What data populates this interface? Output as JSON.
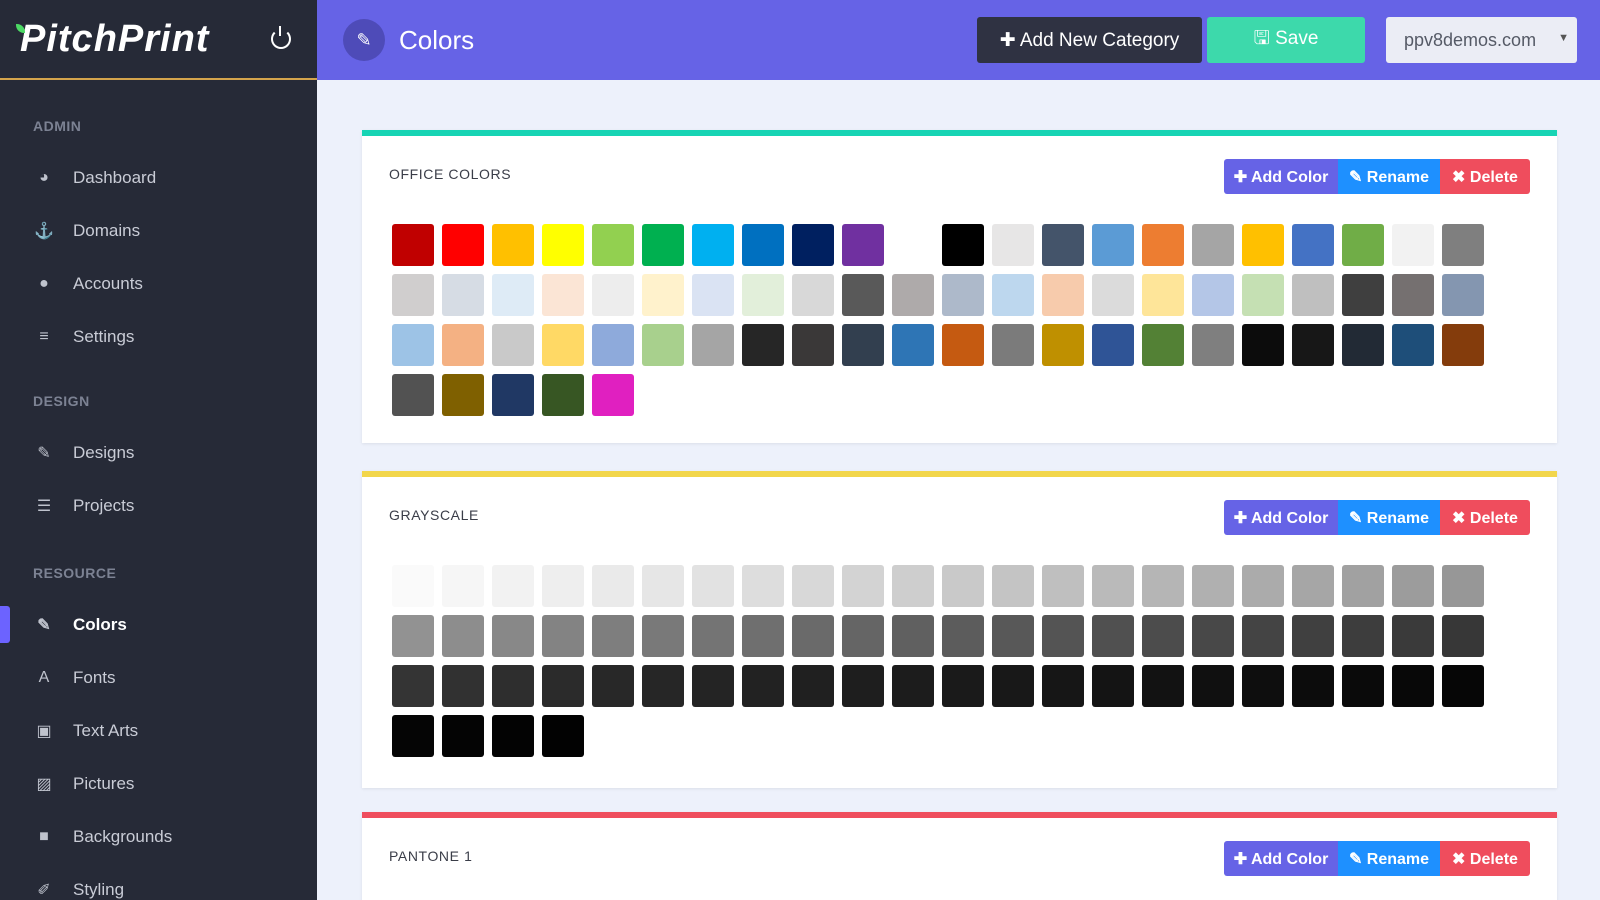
{
  "app": {
    "logo": "PitchPrint"
  },
  "sidebar": {
    "sections": [
      {
        "label": "ADMIN",
        "items": [
          {
            "label": "Dashboard",
            "icon": "dashboard-icon"
          },
          {
            "label": "Domains",
            "icon": "anchor-icon"
          },
          {
            "label": "Accounts",
            "icon": "user-icon"
          },
          {
            "label": "Settings",
            "icon": "sliders-icon"
          }
        ]
      },
      {
        "label": "DESIGN",
        "items": [
          {
            "label": "Designs",
            "icon": "edit-icon"
          },
          {
            "label": "Projects",
            "icon": "list-icon"
          }
        ]
      },
      {
        "label": "RESOURCE",
        "items": [
          {
            "label": "Colors",
            "icon": "eyedropper-icon",
            "active": true
          },
          {
            "label": "Fonts",
            "icon": "font-icon"
          },
          {
            "label": "Text Arts",
            "icon": "textart-icon"
          },
          {
            "label": "Pictures",
            "icon": "picture-icon"
          },
          {
            "label": "Backgrounds",
            "icon": "square-icon"
          },
          {
            "label": "Styling",
            "icon": "brush-icon"
          }
        ]
      }
    ]
  },
  "header": {
    "title": "Colors",
    "add_category_label": "Add New Category",
    "save_label": "Save",
    "domain_value": "ppv8demos.com"
  },
  "actions": {
    "add": "Add Color",
    "rename": "Rename",
    "delete": "Delete"
  },
  "categories": [
    {
      "name": "OFFICE COLORS",
      "accent": "#17d4b4",
      "swatches": [
        "#c00000",
        "#ff0000",
        "#ffc000",
        "#ffff00",
        "#92d050",
        "#00b050",
        "#00b0f0",
        "#0070c0",
        "#002060",
        "#7030a0",
        "#ffffff",
        "#000000",
        "#e7e6e6",
        "#44546a",
        "#5b9bd5",
        "#ed7d31",
        "#a5a5a5",
        "#ffc000",
        "#4472c4",
        "#70ad47",
        "#f2f2f2",
        "#7f7f7f",
        "#d0cece",
        "#d6dce4",
        "#deebf6",
        "#fbe5d5",
        "#ededed",
        "#fff2cc",
        "#dae3f3",
        "#e2efda",
        "#d8d8d8",
        "#595959",
        "#aeaaaa",
        "#adb9ca",
        "#bdd7ee",
        "#f7cbac",
        "#dbdbdb",
        "#fee599",
        "#b4c6e7",
        "#c5e0b3",
        "#bfbfbf",
        "#3f3f3f",
        "#757070",
        "#8496b0",
        "#9dc3e6",
        "#f4b183",
        "#c9c9c9",
        "#ffd965",
        "#8eaadb",
        "#a8d08d",
        "#a5a5a5",
        "#262626",
        "#3a3838",
        "#323f4f",
        "#2e75b5",
        "#c55a11",
        "#7b7b7b",
        "#bf9000",
        "#2f5496",
        "#538135",
        "#7f7f7f",
        "#0c0c0c",
        "#171717",
        "#222a35",
        "#1e4e79",
        "#843c0c",
        "#525252",
        "#7f6000",
        "#203864",
        "#375623",
        "#e020c0"
      ]
    },
    {
      "name": "GRAYSCALE",
      "accent": "#f2d64b",
      "swatches": [
        "#fafafa",
        "#f6f6f6",
        "#f2f2f2",
        "#eeeeee",
        "#eaeaea",
        "#e6e6e6",
        "#e2e2e2",
        "#dddddd",
        "#d8d8d8",
        "#d3d3d3",
        "#cecece",
        "#c9c9c9",
        "#c4c4c4",
        "#bfbfbf",
        "#bababa",
        "#b5b5b5",
        "#b0b0b0",
        "#ababab",
        "#a6a6a6",
        "#a1a1a1",
        "#9c9c9c",
        "#979797",
        "#929292",
        "#8d8d8d",
        "#888888",
        "#838383",
        "#7e7e7e",
        "#797979",
        "#747474",
        "#6f6f6f",
        "#6a6a6a",
        "#656565",
        "#606060",
        "#5c5c5c",
        "#585858",
        "#545454",
        "#505050",
        "#4c4c4c",
        "#484848",
        "#444444",
        "#404040",
        "#3d3d3d",
        "#3a3a3a",
        "#373737",
        "#343434",
        "#313131",
        "#2e2e2e",
        "#2b2b2b",
        "#282828",
        "#262626",
        "#242424",
        "#222222",
        "#202020",
        "#1e1e1e",
        "#1c1c1c",
        "#1a1a1a",
        "#181818",
        "#161616",
        "#141414",
        "#121212",
        "#101010",
        "#0e0e0e",
        "#0c0c0c",
        "#0a0a0a",
        "#080808",
        "#060606",
        "#050505",
        "#040404",
        "#030303",
        "#020202"
      ]
    },
    {
      "name": "PANTONE 1",
      "accent": "#ef4d5d",
      "swatches": []
    }
  ]
}
